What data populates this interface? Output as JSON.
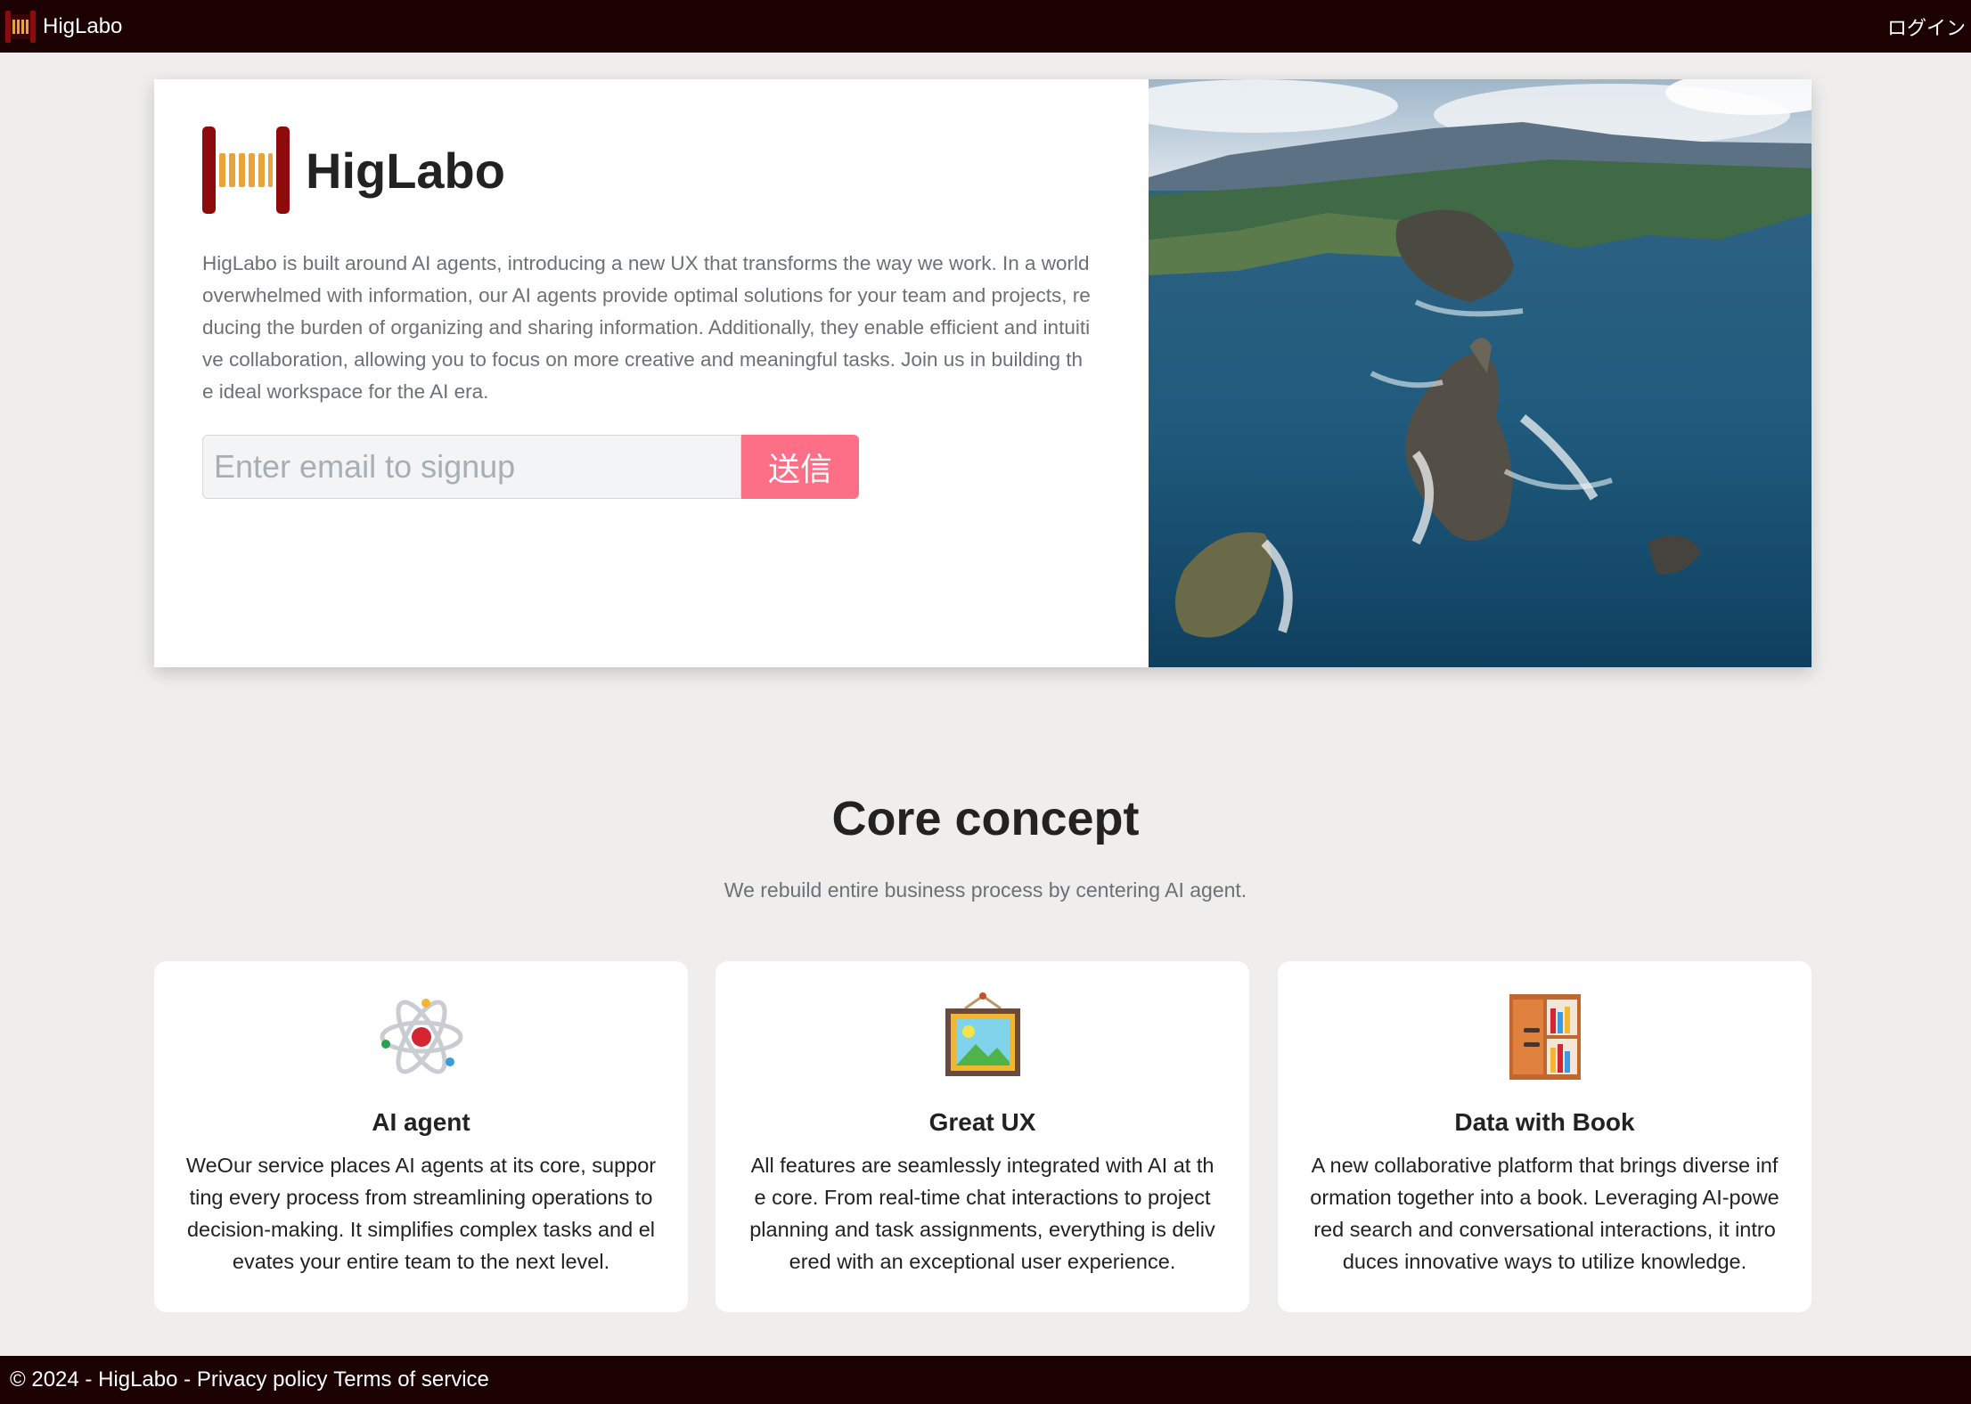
{
  "nav": {
    "brand": "HigLabo",
    "login": "ログイン"
  },
  "hero": {
    "title": "HigLabo",
    "description": "HigLabo is built around AI agents, introducing a new UX that transforms the way we work. In a world overwhelmed with information, our AI agents provide optimal solutions for your team and projects, reducing the burden of organizing and sharing information. Additionally, they enable efficient and intuitive collaboration, allowing you to focus on more creative and meaningful tasks. Join us in building the ideal workspace for the AI era.",
    "email_placeholder": "Enter email to signup",
    "submit_label": "送信",
    "image_icon": "coastal-landscape-photo"
  },
  "concept": {
    "title": "Core concept",
    "subtitle": "We rebuild entire business process by centering AI agent.",
    "cards": [
      {
        "icon": "atom-icon",
        "title": "AI agent",
        "text": "WeOur service places AI agents at its core, supporting every process from streamlining operations to decision-making. It simplifies complex tasks and elevates your entire team to the next level."
      },
      {
        "icon": "framed-picture-icon",
        "title": "Great UX",
        "text": "All features are seamlessly integrated with AI at the core. From real-time chat interactions to project planning and task assignments, everything is delivered with an exceptional user experience."
      },
      {
        "icon": "bookshelf-icon",
        "title": "Data with Book",
        "text": "A new collaborative platform that brings diverse information together into a book. Leveraging AI-powered search and conversational interactions, it introduces innovative ways to utilize knowledge."
      }
    ]
  },
  "footer": {
    "copyright": "© 2024 - HigLabo -",
    "privacy": "Privacy policy",
    "terms": "Terms of service"
  },
  "colors": {
    "nav_bg": "#1c0202",
    "accent": "#fd6f87",
    "logo_red": "#8e0b0b",
    "logo_gold": "#e8a33a"
  }
}
